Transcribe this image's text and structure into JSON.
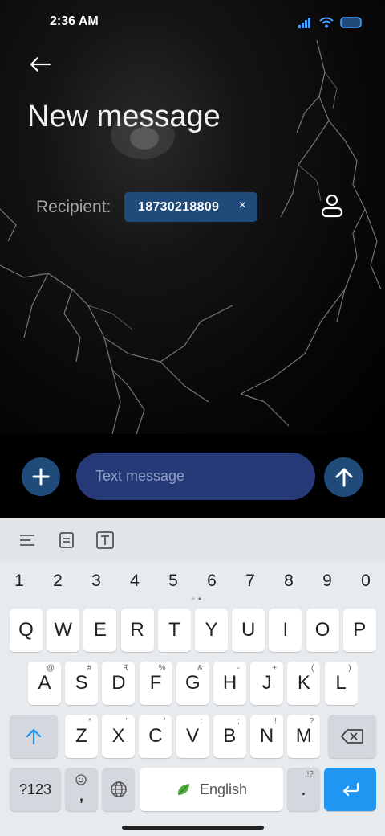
{
  "status_bar": {
    "time": "2:36 AM"
  },
  "header": {
    "title": "New message"
  },
  "recipient": {
    "label": "Recipient:",
    "chip_value": "18730218809",
    "chip_close": "×"
  },
  "composer": {
    "placeholder": "Text message"
  },
  "keyboard": {
    "numbers": [
      "1",
      "2",
      "3",
      "4",
      "5",
      "6",
      "7",
      "8",
      "9",
      "0"
    ],
    "row1": [
      "Q",
      "W",
      "E",
      "R",
      "T",
      "Y",
      "U",
      "I",
      "O",
      "P"
    ],
    "row2": [
      {
        "key": "A",
        "hint": "@"
      },
      {
        "key": "S",
        "hint": "#"
      },
      {
        "key": "D",
        "hint": "₹"
      },
      {
        "key": "F",
        "hint": "%"
      },
      {
        "key": "G",
        "hint": "&"
      },
      {
        "key": "H",
        "hint": "-"
      },
      {
        "key": "J",
        "hint": "+"
      },
      {
        "key": "K",
        "hint": "("
      },
      {
        "key": "L",
        "hint": ")"
      }
    ],
    "row3": [
      {
        "key": "Z",
        "hint": "*"
      },
      {
        "key": "X",
        "hint": "\""
      },
      {
        "key": "C",
        "hint": "'"
      },
      {
        "key": "V",
        "hint": ":"
      },
      {
        "key": "B",
        "hint": ";"
      },
      {
        "key": "N",
        "hint": "!"
      },
      {
        "key": "M",
        "hint": "?"
      }
    ],
    "symbols_label": "?123",
    "comma_label": ",",
    "space_label": "English",
    "period_label": ".",
    "period_hint": ",!?"
  },
  "colors": {
    "accent": "#1f4a7a",
    "input_bg": "#273a78",
    "enter_key": "#1e96f2"
  }
}
